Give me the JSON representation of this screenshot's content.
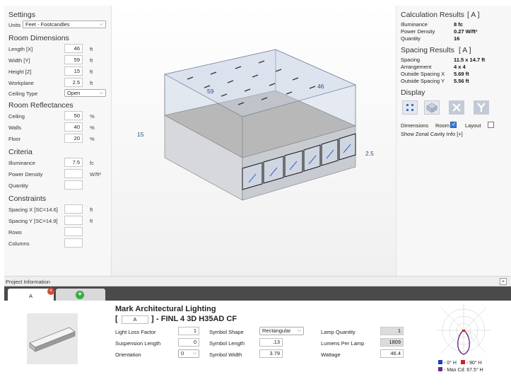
{
  "settings": {
    "title": "Settings",
    "units_label": "Units",
    "units_value": "Feet - Footcandles"
  },
  "room_dimensions": {
    "title": "Room Dimensions",
    "length_label": "Length [X]",
    "length_value": "46",
    "length_unit": "ft",
    "width_label": "Width [Y]",
    "width_value": "59",
    "width_unit": "ft",
    "height_label": "Height [Z]",
    "height_value": "15",
    "height_unit": "ft",
    "workplane_label": "Workplane",
    "workplane_value": "2.5",
    "workplane_unit": "ft",
    "ceiling_type_label": "Ceiling Type",
    "ceiling_type_value": "Open"
  },
  "room_reflectances": {
    "title": "Room Reflectances",
    "ceiling_label": "Ceiling",
    "ceiling_value": "50",
    "ceiling_unit": "%",
    "walls_label": "Walls",
    "walls_value": "40",
    "walls_unit": "%",
    "floor_label": "Floor",
    "floor_value": "20",
    "floor_unit": "%"
  },
  "criteria": {
    "title": "Criteria",
    "illuminance_label": "Illuminance",
    "illuminance_value": "7.5",
    "illuminance_unit": "fc",
    "power_density_label": "Power Density",
    "power_density_value": "",
    "power_density_unit": "W/ft²",
    "quantity_label": "Quantity",
    "quantity_value": ""
  },
  "constraints": {
    "title": "Constraints",
    "spacing_x_label": "Spacing X   [SC=14.6]",
    "spacing_x_value": "",
    "spacing_x_unit": "ft",
    "spacing_y_label": "Spacing Y   [SC=14.9]",
    "spacing_y_value": "",
    "spacing_y_unit": "ft",
    "rows_label": "Rows",
    "rows_value": "",
    "columns_label": "Columns",
    "columns_value": ""
  },
  "view": {
    "dim_width": "59",
    "dim_length": "46",
    "dim_height": "15",
    "dim_workplane": "2.5"
  },
  "calculation_results": {
    "title": "Calculation Results",
    "tag": "[ A ]",
    "rows": [
      {
        "label": "Illuminance",
        "value": "8  fc"
      },
      {
        "label": "Power Density",
        "value": "0.27  W/ft²"
      },
      {
        "label": "Quantity",
        "value": "16"
      }
    ]
  },
  "spacing_results": {
    "title": "Spacing Results",
    "tag": "[ A ]",
    "rows": [
      {
        "label": "Spacing",
        "value": "11.5 x 14.7  ft"
      },
      {
        "label": "Arrangement",
        "value": "4 x 4"
      },
      {
        "label": "Outside Spacing X",
        "value": "5.69  ft"
      },
      {
        "label": "Outside Spacing Y",
        "value": "5.56  ft"
      }
    ]
  },
  "display": {
    "title": "Display",
    "dimensions_label": "Dimensions",
    "room_label": "Room",
    "room_checked": true,
    "layout_label": "Layout",
    "layout_checked": false,
    "zonal_link": "Show Zonal Cavity Info [+]"
  },
  "project": {
    "title": "Project Information",
    "expand_glyph": "+"
  },
  "tabs": [
    {
      "label": "A",
      "active": true
    }
  ],
  "fixture": {
    "manufacturer": "Mark Architectural Lighting",
    "type_tag": "A",
    "bracket_open": "[",
    "bracket_close": "]",
    "catalog": " - FINL 4 3D H35AD CF",
    "light_loss_factor_label": "Light Loss Factor",
    "light_loss_factor_value": "1",
    "suspension_length_label": "Suspension Length",
    "suspension_length_value": "0",
    "orientation_label": "Orientation",
    "orientation_value": "0",
    "symbol_shape_label": "Symbol Shape",
    "symbol_shape_value": "Rectangular",
    "symbol_length_label": "Symbol Length",
    "symbol_length_value": ".13",
    "symbol_width_label": "Symbol Width",
    "symbol_width_value": "3.79",
    "lamp_quantity_label": "Lamp Quantity",
    "lamp_quantity_value": "1",
    "lumens_per_lamp_label": "Lumens Per Lamp",
    "lumens_per_lamp_value": "1809",
    "wattage_label": "Wattage",
    "wattage_value": "46.4"
  },
  "polar_legend": {
    "zero_h": "- 0° H",
    "ninety_h": "- 90° H",
    "max_cd": "- Max Cd: 67.5° H"
  },
  "colors": {
    "zero_h": "#1f3fbf",
    "ninety_h": "#d02020",
    "max_cd": "#6a2a8a",
    "room_glass": "#c9d6e8",
    "floor": "#b8b8b8"
  }
}
